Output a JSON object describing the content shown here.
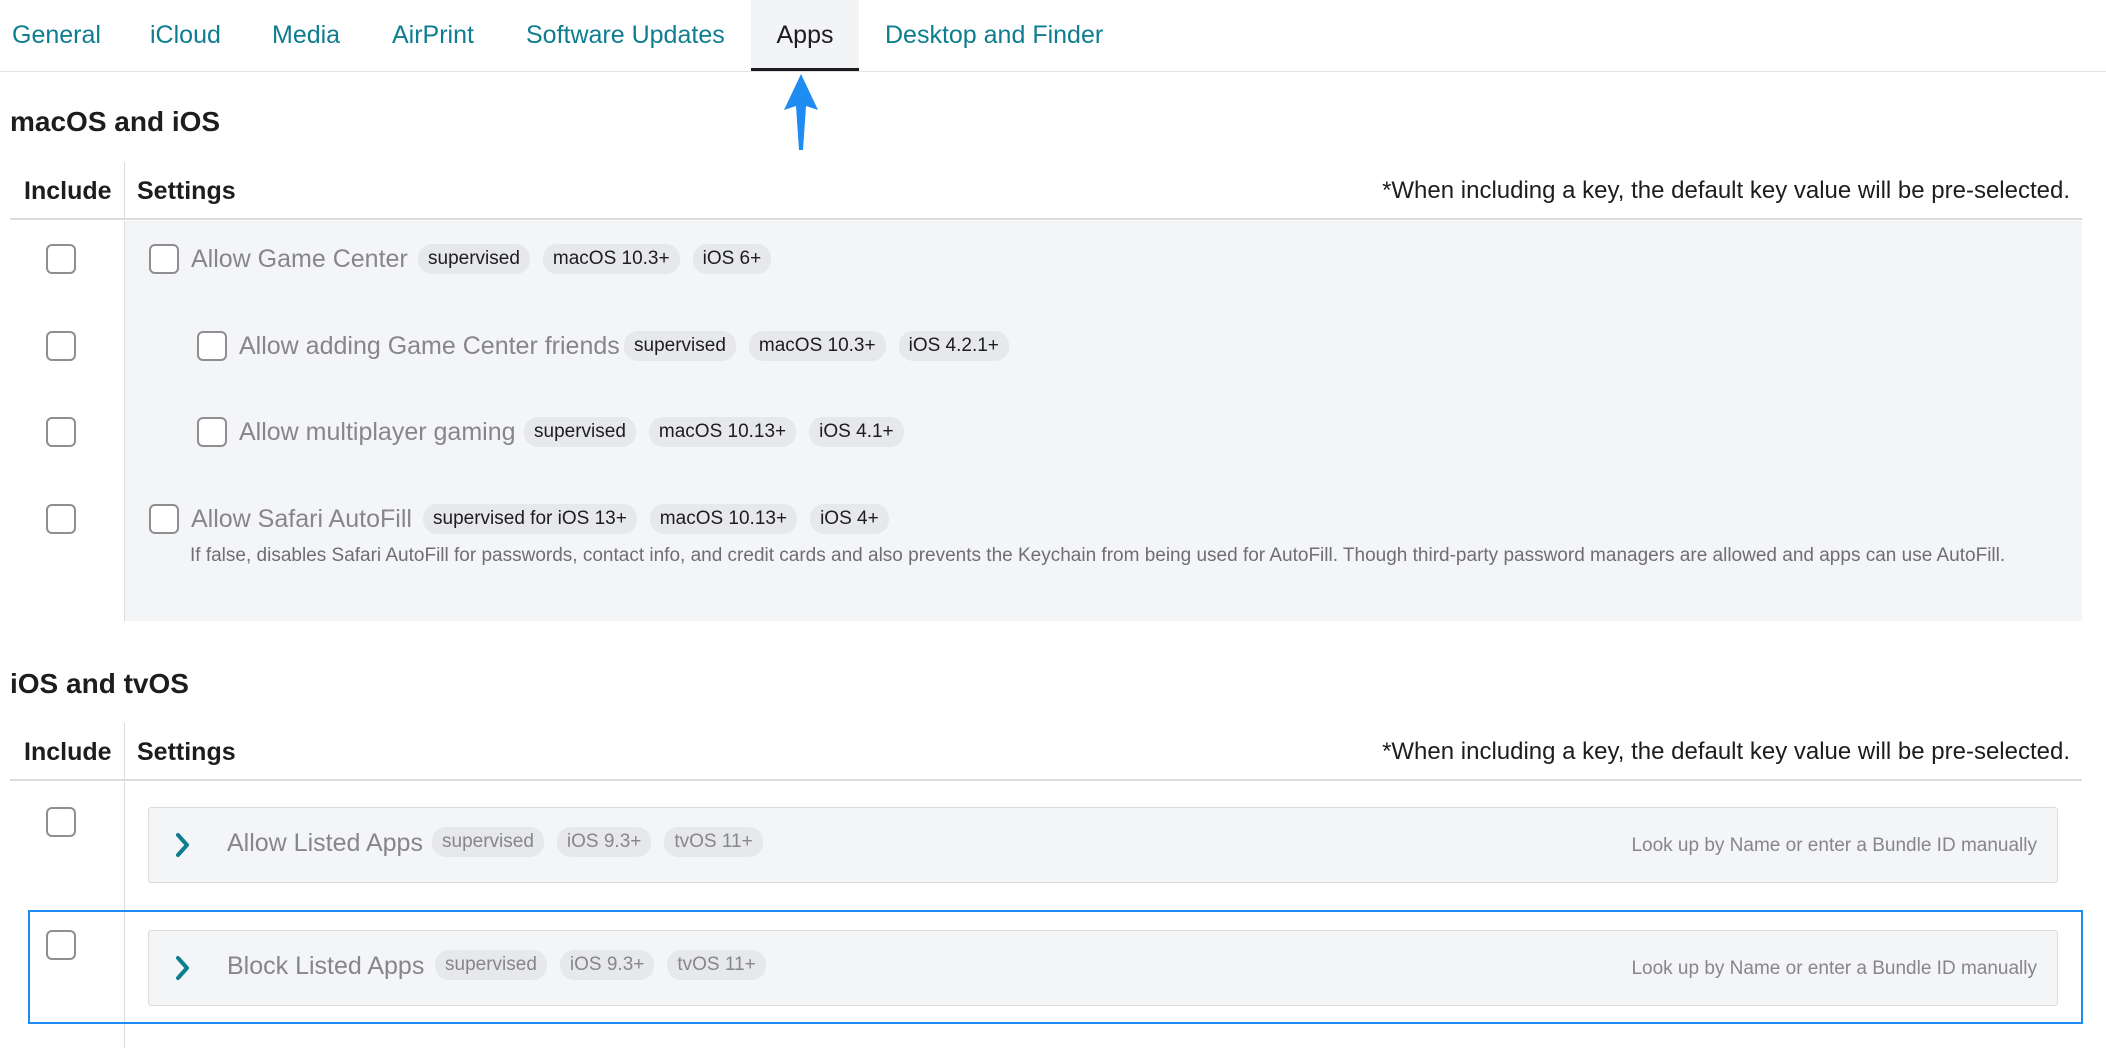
{
  "tabs": [
    {
      "label": "General"
    },
    {
      "label": "iCloud"
    },
    {
      "label": "Media"
    },
    {
      "label": "AirPrint"
    },
    {
      "label": "Software Updates"
    },
    {
      "label": "Apps",
      "active": true
    },
    {
      "label": "Desktop and Finder"
    }
  ],
  "colors": {
    "link": "#0d7d8f",
    "highlight": "#1e8cf0",
    "panel": "#f4f5f7"
  },
  "section1": {
    "title": "macOS and iOS",
    "col_include": "Include",
    "col_settings": "Settings",
    "note": "*When including a key, the default key value will be pre-selected.",
    "rows": [
      {
        "label": "Allow Game Center",
        "badges": [
          "supervised",
          "macOS 10.3+",
          "iOS 6+"
        ]
      },
      {
        "label": "Allow adding Game Center friends",
        "badges": [
          "supervised",
          "macOS 10.3+",
          "iOS 4.2.1+"
        ]
      },
      {
        "label": "Allow multiplayer gaming",
        "badges": [
          "supervised",
          "macOS 10.13+",
          "iOS 4.1+"
        ]
      },
      {
        "label": "Allow Safari AutoFill",
        "badges": [
          "supervised for iOS 13+",
          "macOS 10.13+",
          "iOS 4+"
        ],
        "description": "If false, disables Safari AutoFill for passwords, contact info, and credit cards and also prevents the Keychain from being used for AutoFill. Though third-party password managers are allowed and apps can use AutoFill."
      }
    ]
  },
  "section2": {
    "title": "iOS and tvOS",
    "col_include": "Include",
    "col_settings": "Settings",
    "note": "*When including a key, the default key value will be pre-selected.",
    "rows": [
      {
        "label": "Allow Listed Apps",
        "badges": [
          "supervised",
          "iOS 9.3+",
          "tvOS 11+"
        ],
        "hint": "Look up by Name or enter a Bundle ID manually"
      },
      {
        "label": "Block Listed Apps",
        "badges": [
          "supervised",
          "iOS 9.3+",
          "tvOS 11+"
        ],
        "hint": "Look up by Name or enter a Bundle ID manually"
      }
    ]
  }
}
